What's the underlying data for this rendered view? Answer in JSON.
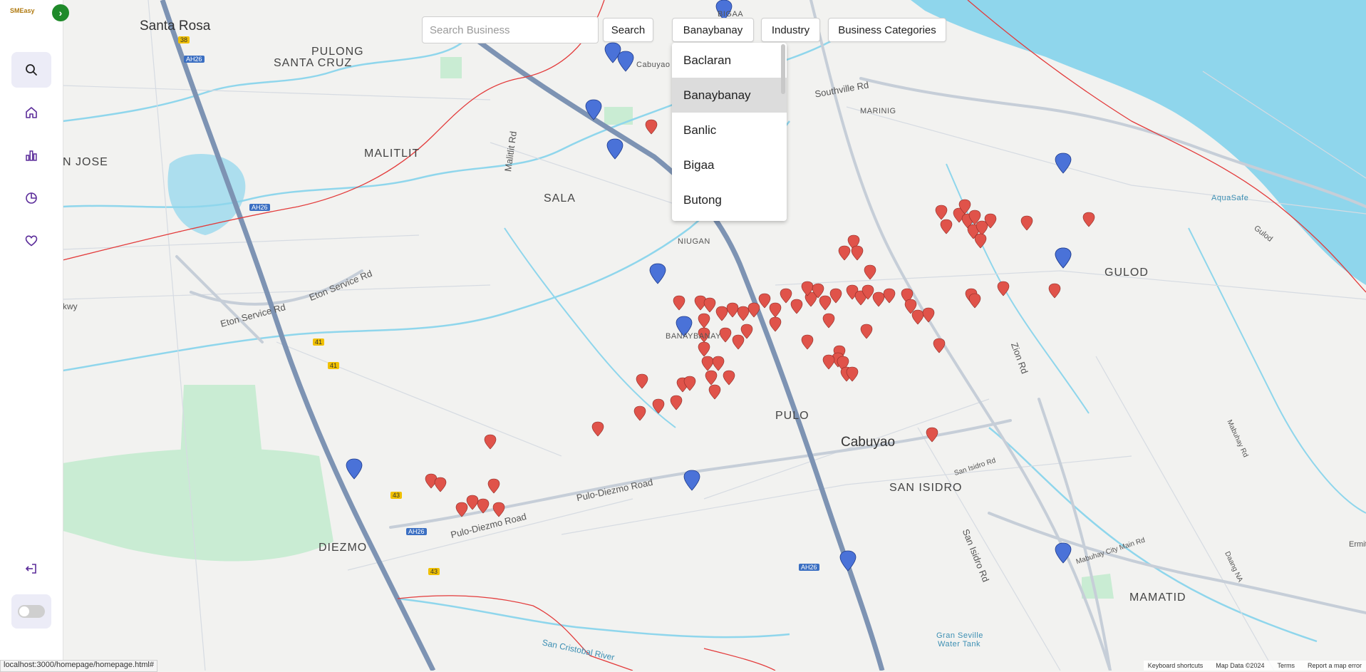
{
  "app": {
    "logo_text": "SMEasy"
  },
  "search": {
    "placeholder": "Search Business",
    "value": "",
    "button_label": "Search"
  },
  "filters": {
    "barangay_label": "Banaybanay",
    "industry_label": "Industry",
    "categories_label": "Business Categories"
  },
  "dropdown": {
    "items": [
      "Baclaran",
      "Banaybanay",
      "Banlic",
      "Bigaa",
      "Butong"
    ],
    "selected": "Banaybanay"
  },
  "sidebar": {
    "items": [
      {
        "name": "search",
        "icon": "search-icon"
      },
      {
        "name": "home",
        "icon": "home-icon"
      },
      {
        "name": "analytics",
        "icon": "bar-chart-icon"
      },
      {
        "name": "reports",
        "icon": "pie-chart-icon"
      },
      {
        "name": "favorites",
        "icon": "heart-icon"
      }
    ],
    "logout_icon": "logout-icon",
    "theme_toggle_icon": "toggle-icon"
  },
  "map": {
    "places": {
      "santa_rosa": "Santa Rosa",
      "pulong_santa_cruz_1": "PULONG",
      "pulong_santa_cruz_2": "SANTA CRUZ",
      "malitlit": "MALITLIT",
      "san_jose": "N JOSE",
      "sala": "SALA",
      "niugan": "NIUGAN",
      "banaybanay": "BANAYBANAY",
      "pulo": "PULO",
      "cabuyao": "Cabuyao",
      "cabuyao_top": "Cabuyao",
      "san_isidro": "SAN ISIDRO",
      "diezmo": "DIEZMO",
      "gulod": "GULOD",
      "marinig": "MARINIG",
      "mamatid": "MAMATID",
      "bigaa": "BIGAA",
      "aquasafe": "AquaSafe",
      "gran_seville_1": "Gran Seville",
      "gran_seville_2": "Water Tank"
    },
    "roads": {
      "eton_service_1": "Eton Service Rd",
      "eton_service_2": "Eton Service Rd",
      "malitlit_rd": "Malitlit Rd",
      "southville_rd": "Southville Rd",
      "pulo_diezmo_1": "Pulo-Diezmo Road",
      "pulo_diezmo_2": "Pulo-Diezmo Road",
      "zion_rd": "Zion Rd",
      "san_isidro_rd": "San Isidro Rd",
      "san_isidro_rd_2": "San Isidro Rd",
      "mabuhay_rd": "Mabuhay Rd",
      "mabuhay_city": "Mabuhay City Main Rd",
      "daang_na": "Daang NA",
      "gulod_rd": "Gulod",
      "san_cristobal": "San Cristobal River",
      "kwy": "kwy",
      "ermit": "Ermit"
    },
    "shields": {
      "ah26_a": "AH26",
      "ah26_b": "AH26",
      "ah26_c": "AH26",
      "ah26_d": "AH26",
      "r38": "38",
      "r41_a": "41",
      "r41_b": "41",
      "r43_a": "43",
      "r43_b": "43"
    },
    "attribution": {
      "shortcuts": "Keyboard shortcuts",
      "map_data": "Map Data ©2024",
      "terms": "Terms",
      "report": "Report a map error"
    }
  },
  "status_bar": {
    "url": "localhost:3000/homepage/homepage.html#"
  },
  "colors": {
    "accent": "#5b2c9a",
    "water": "#8fd6ec",
    "marker_red": "#e0534a",
    "marker_blue": "#4a72d8",
    "boundary": "#e33b3b",
    "highway": "#7d93b3"
  }
}
